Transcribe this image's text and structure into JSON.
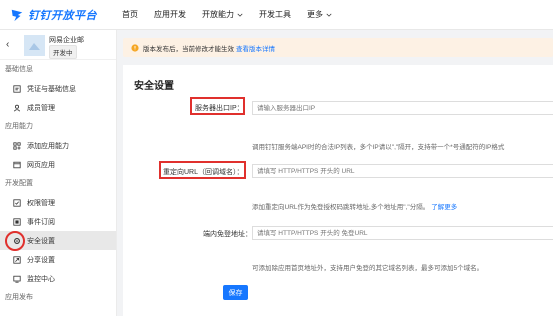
{
  "colors": {
    "brand": "#1677ff",
    "highlight": "#e0302d",
    "notice_bg": "#fdf1e4"
  },
  "topnav": {
    "logo_text": "钉钉开放平台",
    "items": [
      {
        "label": "首页"
      },
      {
        "label": "应用开发"
      },
      {
        "label": "开放能力",
        "has_dropdown": true
      },
      {
        "label": "开发工具"
      },
      {
        "label": "更多",
        "has_dropdown": true
      }
    ]
  },
  "sidebar": {
    "app_name": "网易企业邮",
    "app_status": "开发中",
    "sections": [
      {
        "title": "基础信息",
        "items": [
          {
            "label": "凭证与基础信息",
            "icon": "credential-icon"
          },
          {
            "label": "成员管理",
            "icon": "member-icon"
          }
        ]
      },
      {
        "title": "应用能力",
        "items": [
          {
            "label": "添加应用能力",
            "icon": "add-capability-icon"
          },
          {
            "label": "网页应用",
            "icon": "web-app-icon"
          }
        ]
      },
      {
        "title": "开发配置",
        "items": [
          {
            "label": "权限管理",
            "icon": "permission-icon"
          },
          {
            "label": "事件订阅",
            "icon": "event-icon"
          },
          {
            "label": "安全设置",
            "icon": "security-gear-icon",
            "active": true
          },
          {
            "label": "分享设置",
            "icon": "share-icon"
          },
          {
            "label": "监控中心",
            "icon": "monitor-icon"
          }
        ]
      },
      {
        "title": "应用发布",
        "items": []
      }
    ]
  },
  "notice": {
    "text": "版本发布后，当前修改才能生效",
    "link": "查看版本详情"
  },
  "main": {
    "title": "安全设置",
    "fields": [
      {
        "label": "服务器出口IP：",
        "placeholder": "请输入服务器出口IP",
        "help": "调用钉钉服务端API时的合法IP列表，多个IP请以\",\"隔开，支持带一个*号通配符的IP格式",
        "help_link": ""
      },
      {
        "label": "重定向URL（回调域名）：",
        "placeholder": "请填写 HTTP/HTTPS 开头的 URL",
        "help": "添加重定向URL作为免登授权码跳转地址,多个地址用\",\"分隔。",
        "help_link": "了解更多"
      },
      {
        "label": "端内免登地址：",
        "placeholder": "请填写 HTTP/HTTPS 开头的 免登URL",
        "help": "可添加除应用首页地址外，支持用户免登的其它域名列表，最多可添加5个域名。",
        "help_link": ""
      }
    ],
    "save_label": "保存"
  }
}
